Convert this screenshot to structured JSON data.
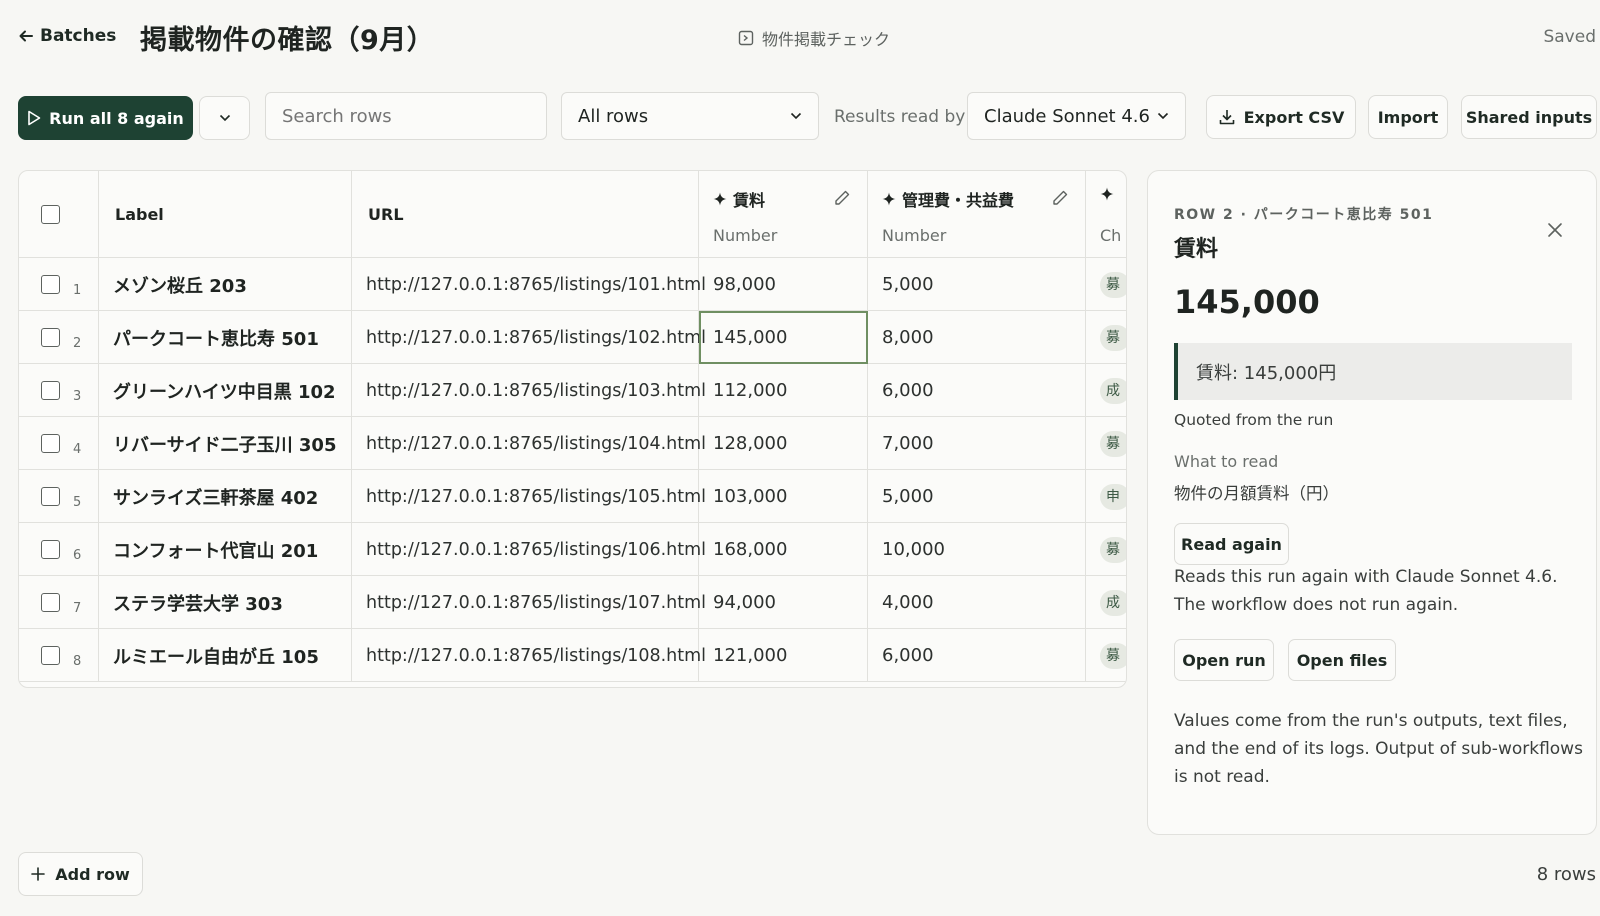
{
  "header": {
    "back_label": "Batches",
    "title": "掲載物件の確認（9月）",
    "workflow_label": "物件掲載チェック",
    "status": "Saved"
  },
  "toolbar": {
    "run_label": "Run all 8 again",
    "search_placeholder": "Search rows",
    "filter_value": "All rows",
    "results_label": "Results read by",
    "model_value": "Claude Sonnet 4.6",
    "export_label": "Export CSV",
    "import_label": "Import",
    "shared_label": "Shared inputs"
  },
  "table": {
    "columns": [
      {
        "label": "Label"
      },
      {
        "label": "URL"
      },
      {
        "label": "賃料",
        "type": "Number"
      },
      {
        "label": "管理費・共益費",
        "type": "Number"
      },
      {
        "label": "Ch"
      }
    ],
    "rows": [
      {
        "num": "1",
        "label": "メゾン桜丘 203",
        "url": "http://127.0.0.1:8765/listings/101.html",
        "rent": "98,000",
        "fee": "5,000",
        "status": "募"
      },
      {
        "num": "2",
        "label": "パークコート恵比寿 501",
        "url": "http://127.0.0.1:8765/listings/102.html",
        "rent": "145,000",
        "fee": "8,000",
        "status": "募"
      },
      {
        "num": "3",
        "label": "グリーンハイツ中目黒 102",
        "url": "http://127.0.0.1:8765/listings/103.html",
        "rent": "112,000",
        "fee": "6,000",
        "status": "成"
      },
      {
        "num": "4",
        "label": "リバーサイド二子玉川 305",
        "url": "http://127.0.0.1:8765/listings/104.html",
        "rent": "128,000",
        "fee": "7,000",
        "status": "募"
      },
      {
        "num": "5",
        "label": "サンライズ三軒茶屋 402",
        "url": "http://127.0.0.1:8765/listings/105.html",
        "rent": "103,000",
        "fee": "5,000",
        "status": "申"
      },
      {
        "num": "6",
        "label": "コンフォート代官山 201",
        "url": "http://127.0.0.1:8765/listings/106.html",
        "rent": "168,000",
        "fee": "10,000",
        "status": "募"
      },
      {
        "num": "7",
        "label": "ステラ学芸大学 303",
        "url": "http://127.0.0.1:8765/listings/107.html",
        "rent": "94,000",
        "fee": "4,000",
        "status": "成"
      },
      {
        "num": "8",
        "label": "ルミエール自由が丘 105",
        "url": "http://127.0.0.1:8765/listings/108.html",
        "rent": "121,000",
        "fee": "6,000",
        "status": "募"
      }
    ]
  },
  "panel": {
    "eyebrow": "ROW 2 · パークコート恵比寿 501",
    "field": "賃料",
    "value": "145,000",
    "quote": "賃料: 145,000円",
    "quote_caption": "Quoted from the run",
    "read_label": "What to read",
    "read_value": "物件の月額賃料（円）",
    "read_again_label": "Read again",
    "read_again_desc": "Reads this run again with Claude Sonnet 4.6. The workflow does not run again.",
    "open_run_label": "Open run",
    "open_files_label": "Open files",
    "note": "Values come from the run's outputs, text files, and the end of its logs. Output of sub-workflows is not read."
  },
  "footer": {
    "add_row_label": "Add row",
    "row_count": "8 rows"
  },
  "colors": {
    "accent": "#1e4233",
    "selected_cell": "#6f8f62",
    "background": "#f7f7f4"
  },
  "icons": [
    "arrow-left-icon",
    "workflow-icon",
    "play-icon",
    "chevron-down-icon",
    "download-icon",
    "sparkle-icon",
    "pencil-icon",
    "close-icon",
    "plus-icon"
  ]
}
